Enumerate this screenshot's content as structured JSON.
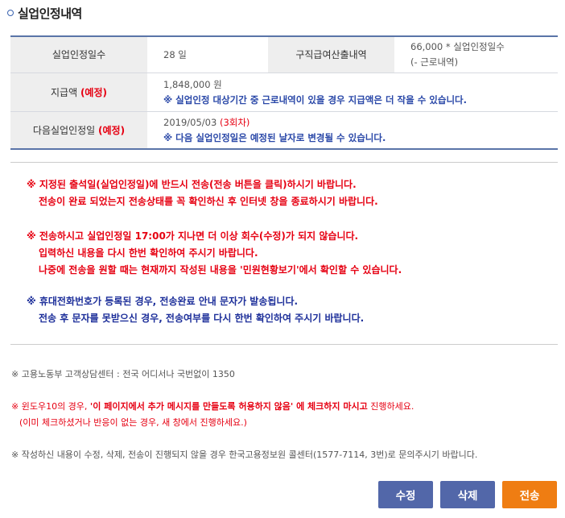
{
  "page": {
    "title": "실업인정내역"
  },
  "summary": {
    "days_label": "실업인정일수",
    "days_value": "28 일",
    "calc_label": "구직급여산출내역",
    "calc_line1": "66,000 * 실업인정일수",
    "calc_line2": "(- 근로내역)",
    "amount_label": "지급액",
    "amount_tag": "(예정)",
    "amount_value": "1,848,000 원",
    "amount_note": "※ 실업인정 대상기간 중 근로내역이 있을 경우 지급액은 더 작을 수 있습니다.",
    "next_label": "다음실업인정일",
    "next_tag": "(예정)",
    "next_date": "2019/05/03",
    "next_round": "(3회차)",
    "next_note": "※ 다음 실업인정일은 예정된 날자로 변경될 수 있습니다."
  },
  "notices": {
    "n1_line1": "※ 지정된 출석일(실업인정일)에 반드시 전송(전송 버튼을 클릭)하시기 바랍니다.",
    "n1_line2": "전송이 완료 되었는지 전송상태를 꼭 확인하신 후 인터넷 창을 종료하시기 바랍니다.",
    "n2_line1": "※ 전송하시고 실업인정일 17:00가 지나면 더 이상 회수(수정)가 되지 않습니다.",
    "n2_line2": "입력하신 내용을 다시 한번 확인하여 주시기 바랍니다.",
    "n2_line3": "나중에 전송을 원할 때는 현재까지 작성된 내용을 '민원현황보기'에서 확인할 수 있습니다.",
    "n3_line1": "※ 휴대전화번호가 등록된 경우, 전송완료 안내 문자가 발송됩니다.",
    "n3_line2": "전송 후 문자를 못받으신 경우, 전송여부를 다시 한번 확인하여 주시기 바랍니다."
  },
  "footer": {
    "center": "※ 고용노동부 고객상담센터 : 전국 어디서나 국번없이 1350",
    "win_pre": "※ 윈도우10의 경우, ",
    "win_bold": "'이 페이지에서 추가 메시지를 만들도록 허용하지 않음' 에 체크하지 마시고",
    "win_post": " 진행하세요.",
    "win_sub": "(이미 체크하셨거나 반응이 없는 경우, 새 창에서 진행하세요.)",
    "callcenter": "※ 작성하신 내용이 수정, 삭제, 전송이 진행되지 않을 경우 한국고용정보원 콜센터(1577-7114, 3번)로 문의주시기 바랍니다."
  },
  "buttons": {
    "edit": "수정",
    "delete": "삭제",
    "send": "전송"
  },
  "colors": {
    "accent_blue": "#5267a9",
    "send_orange": "#ef7d12",
    "warning_red": "#e60012",
    "notice_navy": "#1d2f9a"
  }
}
